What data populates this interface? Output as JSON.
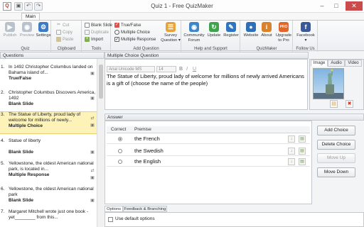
{
  "window": {
    "title": "Quiz 1 - Free QuizMaker",
    "app_icon": "quiz-app-icon",
    "qa_save": "▣",
    "qa_undo": "↶",
    "qa_redo": "↷",
    "btn_min": "–",
    "btn_max": "□",
    "btn_close": "✕"
  },
  "ribbon": {
    "tab": "Main",
    "groups": {
      "quiz": {
        "label": "Quiz",
        "publish": "Publish",
        "preview": "Preview",
        "settings": "Settings"
      },
      "clipboard": {
        "label": "Clipboard",
        "cut": "Cut",
        "copy": "Copy",
        "paste": "Paste"
      },
      "tools": {
        "label": "Tools",
        "blank_slide": "Blank Slide",
        "duplicate": "Duplicate",
        "import": "Import"
      },
      "add_question": {
        "label": "Add Question",
        "true_false": "True/False",
        "multiple_choice": "Multiple Choice",
        "multiple_response": "Multiple Response",
        "survey": "Survey",
        "survey_sub": "Question ▾"
      },
      "help": {
        "label": "Help and Support",
        "community": "Community",
        "community_sub": "Forum",
        "update": "Update",
        "register": "Register"
      },
      "quizmaker": {
        "label": "QuizMaker",
        "website": "Website",
        "about": "About",
        "upgrade": "Upgrade",
        "upgrade_sub": "to Pro"
      },
      "follow": {
        "label": "Follow Us",
        "facebook": "Facebook",
        "facebook_sub": "▾"
      }
    }
  },
  "questions_panel": {
    "title": "Questions",
    "items": [
      {
        "num": "1.",
        "text": "In 1492 Christopher Columbus landed on Bahama island of...",
        "type": "True/False"
      },
      {
        "num": "2.",
        "text": "Christopher Columbus Discovers America, 1492",
        "type": "Blank Slide"
      },
      {
        "num": "3.",
        "text": "The Statue of Liberty, proud lady of welcome for millions of newly...",
        "type": "Multiple Choice"
      },
      {
        "num": "4.",
        "text": "Statue of liberty",
        "type": "Blank Slide"
      },
      {
        "num": "5.",
        "text": "Yellowstone, the oldest American national park, is located in...",
        "type": "Multiple Response"
      },
      {
        "num": "6.",
        "text": "Yellowstone, the oldest American national park",
        "type": "Blank Slide"
      },
      {
        "num": "7.",
        "text": "Margaret Mitchell wrote just one book - yet________ from this...",
        "type": ""
      }
    ]
  },
  "question_editor": {
    "title": "Multiple Choice Question",
    "font_name": "Arial Unicode MS",
    "font_size": "14",
    "bold": "B",
    "italic": "I",
    "underline": "U",
    "text": "The Statue of Liberty, proud lady of welcome for millions of newly arrived Americans is a gift of (choose the name of the people)"
  },
  "media": {
    "tabs": [
      "Image",
      "Audio",
      "Video"
    ],
    "folder_icon": "folder-icon",
    "delete_icon": "delete-icon"
  },
  "answer_panel": {
    "title": "Answer",
    "col_correct": "Correct",
    "col_premise": "Premise",
    "rows": [
      {
        "premise": "the French",
        "correct": true
      },
      {
        "premise": "the Swedish",
        "correct": false
      },
      {
        "premise": "the English",
        "correct": false
      }
    ],
    "add_choice": "Add Choice",
    "delete_choice": "Delete Choice",
    "move_up": "Move Up",
    "move_down": "Move Down"
  },
  "bottom": {
    "tab_options": "Options",
    "tab_feedback": "Feedback & Branching",
    "use_default_options": "Use default options"
  }
}
